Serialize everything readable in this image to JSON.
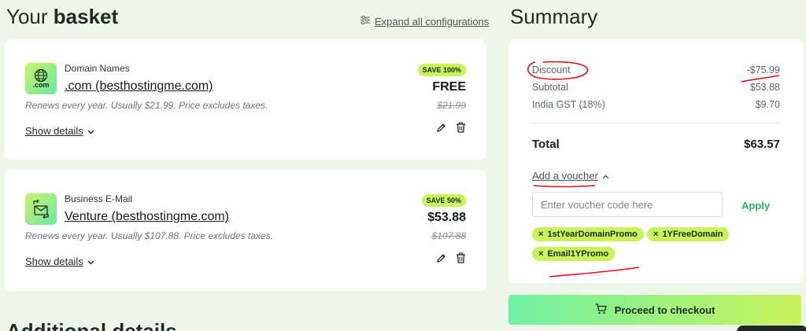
{
  "basket": {
    "title_prefix": "Your ",
    "title_bold": "basket",
    "expand_all_label": "Expand all configurations",
    "items": [
      {
        "icon": "dotcom-icon",
        "icon_text": ".com",
        "category": "Domain Names",
        "name": ".com (besthostingme.com)",
        "renew_text": "Renews every year. Usually $21.99. Price excludes taxes.",
        "badge": "SAVE 100%",
        "price": "FREE",
        "old_price": "$21.99",
        "show_details_label": "Show details"
      },
      {
        "icon": "email-swap-icon",
        "category": "Business E-Mail",
        "name": "Venture (besthostingme.com)",
        "renew_text": "Renews every year. Usually $107.88. Price excludes taxes.",
        "badge": "SAVE 50%",
        "price": "$53.88",
        "old_price": "$107.88",
        "show_details_label": "Show details"
      }
    ]
  },
  "summary": {
    "title": "Summary",
    "rows": [
      {
        "label": "Discount",
        "value": "-$75.99"
      },
      {
        "label": "Subtotal",
        "value": "$53.88"
      },
      {
        "label": "India GST (18%)",
        "value": "$9.70"
      }
    ],
    "total_label": "Total",
    "total_value": "$63.57",
    "voucher_toggle_label": "Add a voucher",
    "voucher_placeholder": "Enter voucher code here",
    "voucher_value": "",
    "apply_label": "Apply",
    "chips": [
      "1stYearDomainPromo",
      "1YFreeDomain",
      "Email1YPromo"
    ],
    "chip_remove_symbol": "×"
  },
  "checkout": {
    "label": "Proceed to checkout"
  },
  "additional": {
    "title": "Additional details"
  },
  "colors": {
    "background": "#eef6ea",
    "badge": "#c8f35a",
    "accent_green": "#2bb45a",
    "annotation_red": "#e0101c"
  }
}
